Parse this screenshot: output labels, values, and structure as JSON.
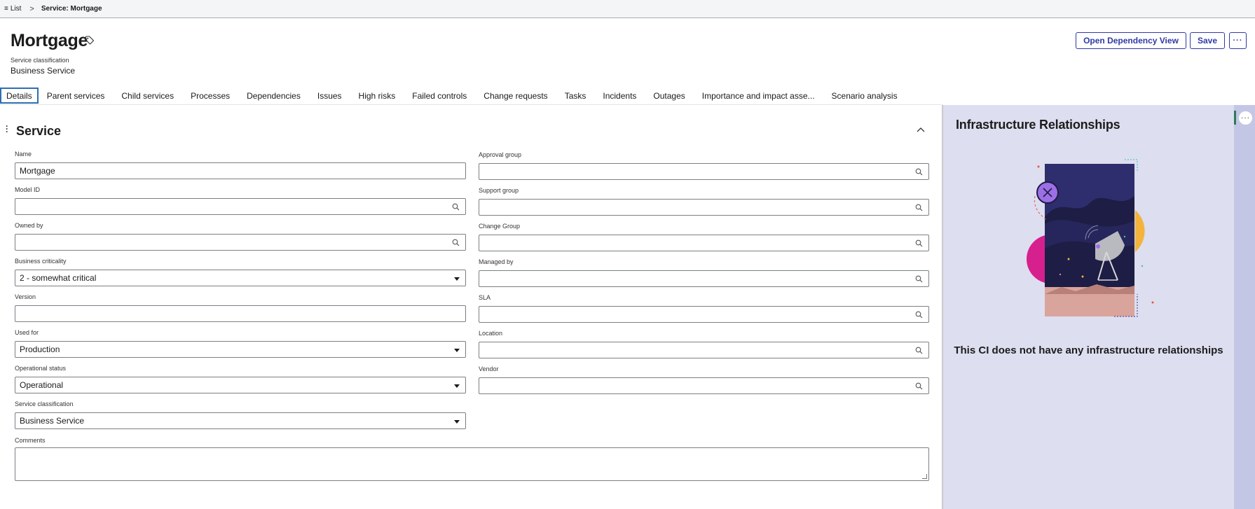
{
  "breadcrumb": {
    "list_label": "List",
    "list_icon": "list-icon",
    "separator": ">",
    "current": "Service: Mortgage"
  },
  "header": {
    "title": "Mortgage",
    "tag_icon": "tag-icon",
    "subtitle_label": "Service classification",
    "subtitle_value": "Business Service",
    "buttons": {
      "dependency_view": "Open Dependency View",
      "save": "Save",
      "more": "···"
    },
    "accent_color": "#2e3aa3"
  },
  "tabs": [
    {
      "label": "Details",
      "active": true
    },
    {
      "label": "Parent services"
    },
    {
      "label": "Child services"
    },
    {
      "label": "Processes"
    },
    {
      "label": "Dependencies"
    },
    {
      "label": "Issues"
    },
    {
      "label": "High risks"
    },
    {
      "label": "Failed controls"
    },
    {
      "label": "Change requests"
    },
    {
      "label": "Tasks"
    },
    {
      "label": "Incidents"
    },
    {
      "label": "Outages"
    },
    {
      "label": "Importance and impact asse..."
    },
    {
      "label": "Scenario analysis"
    }
  ],
  "form": {
    "section_title": "Service",
    "left_fields": [
      {
        "label": "Name",
        "value": "Mortgage",
        "type": "text"
      },
      {
        "label": "Model ID",
        "value": "",
        "type": "reference"
      },
      {
        "label": "Owned by",
        "value": "",
        "type": "reference"
      },
      {
        "label": "Business criticality",
        "value": "2 - somewhat critical",
        "type": "select"
      },
      {
        "label": "Version",
        "value": "",
        "type": "text"
      },
      {
        "label": "Used for",
        "value": "Production",
        "type": "select"
      },
      {
        "label": "Operational status",
        "value": "Operational",
        "type": "select"
      },
      {
        "label": "Service classification",
        "value": "Business Service",
        "type": "select"
      }
    ],
    "right_fields": [
      {
        "label": "Approval group",
        "value": "",
        "type": "reference"
      },
      {
        "label": "Support group",
        "value": "",
        "type": "reference"
      },
      {
        "label": "Change Group",
        "value": "",
        "type": "reference"
      },
      {
        "label": "Managed by",
        "value": "",
        "type": "reference"
      },
      {
        "label": "SLA",
        "value": "",
        "type": "reference"
      },
      {
        "label": "Location",
        "value": "",
        "type": "reference"
      },
      {
        "label": "Vendor",
        "value": "",
        "type": "reference"
      }
    ],
    "comments_label": "Comments",
    "comments_value": ""
  },
  "right_panel": {
    "title": "Infrastructure Relationships",
    "message": "This CI does not have any infrastructure relationships",
    "more": "···",
    "illustration": "satellite-dish-illustration",
    "background": "#dddeef"
  }
}
